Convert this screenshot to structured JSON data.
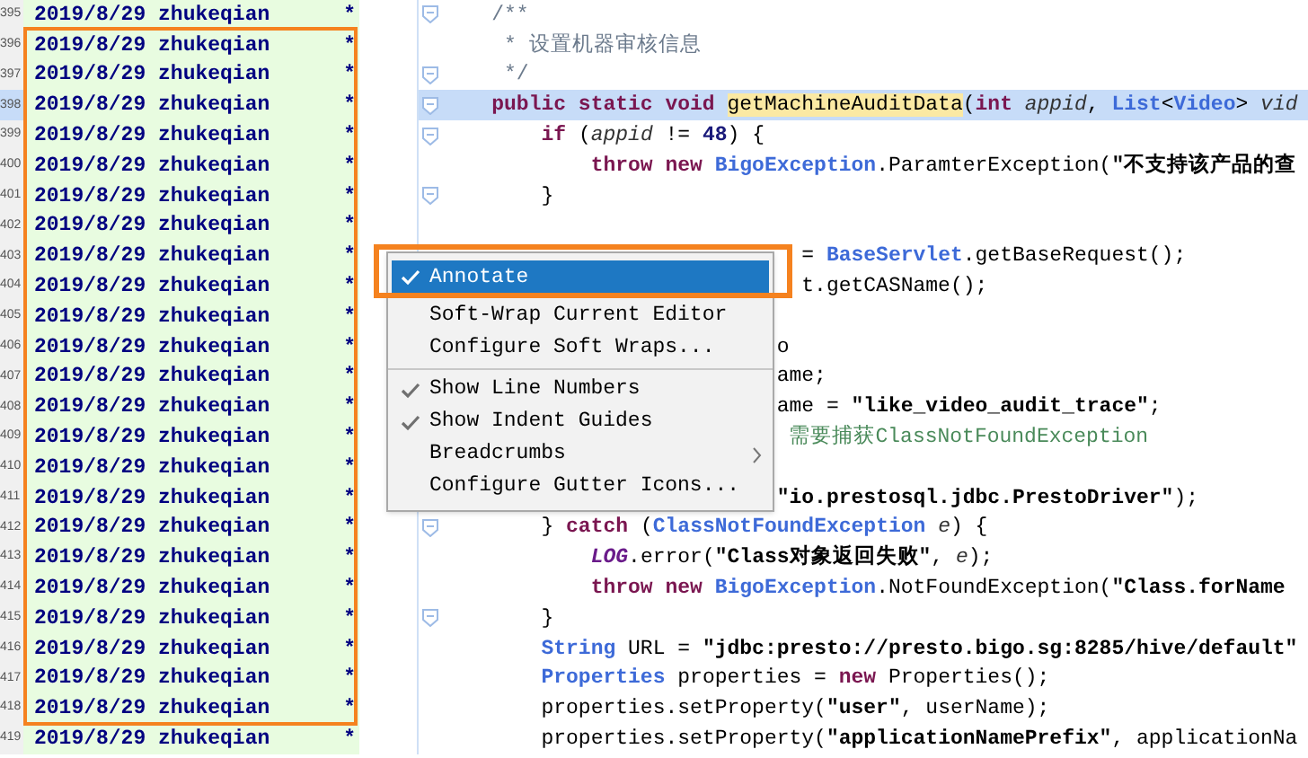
{
  "editor": {
    "lines": [
      {
        "number": "395",
        "annotation": "2019/8/29 zhukeqian",
        "mark": "*",
        "selected": false,
        "fold": true,
        "tokens": [
          {
            "kind": "comment",
            "text": "    /**"
          }
        ]
      },
      {
        "number": "396",
        "annotation": "2019/8/29 zhukeqian",
        "mark": "*",
        "selected": false,
        "fold": false,
        "tokens": [
          {
            "kind": "comment",
            "text": "     * 设置机器审核信息"
          }
        ]
      },
      {
        "number": "397",
        "annotation": "2019/8/29 zhukeqian",
        "mark": "*",
        "selected": false,
        "fold": true,
        "tokens": [
          {
            "kind": "comment",
            "text": "     */"
          }
        ]
      },
      {
        "number": "398",
        "annotation": "2019/8/29 zhukeqian",
        "mark": "*",
        "selected": true,
        "fold": true,
        "tokens": [
          {
            "kind": "keyword",
            "text": "    public static void "
          },
          {
            "kind": "decl",
            "text": "getMachineAuditData"
          },
          {
            "kind": "plain",
            "text": "("
          },
          {
            "kind": "keyword",
            "text": "int "
          },
          {
            "kind": "param",
            "text": "appid"
          },
          {
            "kind": "plain",
            "text": ", "
          },
          {
            "kind": "type",
            "text": "List"
          },
          {
            "kind": "plain",
            "text": "<"
          },
          {
            "kind": "type",
            "text": "Video"
          },
          {
            "kind": "plain",
            "text": "> "
          },
          {
            "kind": "param",
            "text": "vid"
          }
        ]
      },
      {
        "number": "399",
        "annotation": "2019/8/29 zhukeqian",
        "mark": "*",
        "selected": false,
        "fold": true,
        "tokens": [
          {
            "kind": "keyword",
            "text": "        if "
          },
          {
            "kind": "plain",
            "text": "("
          },
          {
            "kind": "param",
            "text": "appid"
          },
          {
            "kind": "plain",
            "text": " != "
          },
          {
            "kind": "number",
            "text": "48"
          },
          {
            "kind": "plain",
            "text": ") {"
          }
        ]
      },
      {
        "number": "400",
        "annotation": "2019/8/29 zhukeqian",
        "mark": "*",
        "selected": false,
        "fold": false,
        "tokens": [
          {
            "kind": "keyword",
            "text": "            throw new "
          },
          {
            "kind": "type",
            "text": "BigoException"
          },
          {
            "kind": "plain",
            "text": ".ParamterException("
          },
          {
            "kind": "string",
            "text": "\"不支持该产品的查"
          }
        ]
      },
      {
        "number": "401",
        "annotation": "2019/8/29 zhukeqian",
        "mark": "*",
        "selected": false,
        "fold": true,
        "tokens": [
          {
            "kind": "plain",
            "text": "        }"
          }
        ]
      },
      {
        "number": "402",
        "annotation": "2019/8/29 zhukeqian",
        "mark": "*",
        "selected": false,
        "fold": false
      },
      {
        "number": "403",
        "annotation": "2019/8/29 zhukeqian",
        "mark": "*",
        "selected": false,
        "fold": false,
        "tokens": [
          {
            "kind": "plain",
            "text": "                             = "
          },
          {
            "kind": "type",
            "text": "BaseServlet"
          },
          {
            "kind": "plain",
            "text": ".getBaseRequest();"
          }
        ]
      },
      {
        "number": "404",
        "annotation": "2019/8/29 zhukeqian",
        "mark": "*",
        "selected": false,
        "fold": false,
        "tokens": [
          {
            "kind": "plain",
            "text": "                             t.getCASName();"
          }
        ]
      },
      {
        "number": "405",
        "annotation": "2019/8/29 zhukeqian",
        "mark": "*",
        "selected": false,
        "fold": false
      },
      {
        "number": "406",
        "annotation": "2019/8/29 zhukeqian",
        "mark": "*",
        "selected": false,
        "fold": false,
        "tokens": [
          {
            "kind": "plain",
            "text": "                           o"
          }
        ]
      },
      {
        "number": "407",
        "annotation": "2019/8/29 zhukeqian",
        "mark": "*",
        "selected": false,
        "fold": false,
        "tokens": [
          {
            "kind": "plain",
            "text": "                           ame;"
          }
        ]
      },
      {
        "number": "408",
        "annotation": "2019/8/29 zhukeqian",
        "mark": "*",
        "selected": false,
        "fold": false,
        "tokens": [
          {
            "kind": "plain",
            "text": "                           ame = "
          },
          {
            "kind": "string",
            "text": "\"like_video_audit_trace\""
          },
          {
            "kind": "plain",
            "text": ";"
          }
        ]
      },
      {
        "number": "409",
        "annotation": "2019/8/29 zhukeqian",
        "mark": "*",
        "selected": false,
        "fold": false,
        "tokens": [
          {
            "kind": "cn_comment",
            "text": "                            需要捕获ClassNotFoundException"
          }
        ]
      },
      {
        "number": "410",
        "annotation": "2019/8/29 zhukeqian",
        "mark": "*",
        "selected": false,
        "fold": false
      },
      {
        "number": "411",
        "annotation": "2019/8/29 zhukeqian",
        "mark": "*",
        "selected": false,
        "fold": false,
        "tokens": [
          {
            "kind": "string",
            "text": "                           \"io.prestosql.jdbc.PrestoDriver\""
          },
          {
            "kind": "plain",
            "text": ");"
          }
        ]
      },
      {
        "number": "412",
        "annotation": "2019/8/29 zhukeqian",
        "mark": "*",
        "selected": false,
        "fold": true,
        "tokens": [
          {
            "kind": "plain",
            "text": "        } "
          },
          {
            "kind": "keyword",
            "text": "catch "
          },
          {
            "kind": "plain",
            "text": "("
          },
          {
            "kind": "type",
            "text": "ClassNotFoundException "
          },
          {
            "kind": "param",
            "text": "e"
          },
          {
            "kind": "plain",
            "text": ") {"
          }
        ]
      },
      {
        "number": "413",
        "annotation": "2019/8/29 zhukeqian",
        "mark": "*",
        "selected": false,
        "fold": false,
        "tokens": [
          {
            "kind": "static",
            "text": "            LOG"
          },
          {
            "kind": "plain",
            "text": ".error("
          },
          {
            "kind": "string",
            "text": "\"Class对象返回失败\""
          },
          {
            "kind": "plain",
            "text": ", "
          },
          {
            "kind": "param",
            "text": "e"
          },
          {
            "kind": "plain",
            "text": ");"
          }
        ]
      },
      {
        "number": "414",
        "annotation": "2019/8/29 zhukeqian",
        "mark": "*",
        "selected": false,
        "fold": false,
        "tokens": [
          {
            "kind": "keyword",
            "text": "            throw new "
          },
          {
            "kind": "type",
            "text": "BigoException"
          },
          {
            "kind": "plain",
            "text": ".NotFoundException("
          },
          {
            "kind": "string",
            "text": "\"Class.forName"
          }
        ]
      },
      {
        "number": "415",
        "annotation": "2019/8/29 zhukeqian",
        "mark": "*",
        "selected": false,
        "fold": true,
        "tokens": [
          {
            "kind": "plain",
            "text": "        }"
          }
        ]
      },
      {
        "number": "416",
        "annotation": "2019/8/29 zhukeqian",
        "mark": "*",
        "selected": false,
        "fold": false,
        "tokens": [
          {
            "kind": "type",
            "text": "        String "
          },
          {
            "kind": "plain",
            "text": "URL = "
          },
          {
            "kind": "string",
            "text": "\"jdbc:presto://presto.bigo.sg:8285/hive/default\""
          }
        ]
      },
      {
        "number": "417",
        "annotation": "2019/8/29 zhukeqian",
        "mark": "*",
        "selected": false,
        "fold": false,
        "tokens": [
          {
            "kind": "type",
            "text": "        Properties "
          },
          {
            "kind": "plain",
            "text": "properties = "
          },
          {
            "kind": "keyword",
            "text": "new "
          },
          {
            "kind": "plain",
            "text": "Properties();"
          }
        ]
      },
      {
        "number": "418",
        "annotation": "2019/8/29 zhukeqian",
        "mark": "*",
        "selected": false,
        "fold": false,
        "tokens": [
          {
            "kind": "plain",
            "text": "        properties.setProperty("
          },
          {
            "kind": "string",
            "text": "\"user\""
          },
          {
            "kind": "plain",
            "text": ", userName);"
          }
        ]
      },
      {
        "number": "419",
        "annotation": "2019/8/29 zhukeqian",
        "mark": "*",
        "selected": false,
        "fold": false,
        "tokens": [
          {
            "kind": "plain",
            "text": "        properties.setProperty("
          },
          {
            "kind": "string",
            "text": "\"applicationNamePrefix\""
          },
          {
            "kind": "plain",
            "text": ", applicationNa"
          }
        ]
      }
    ]
  },
  "context_menu": {
    "items": [
      {
        "kind": "item",
        "label": "Annotate",
        "checked": true,
        "selected": true,
        "submenu": false
      },
      {
        "kind": "item",
        "label": "Soft-Wrap Current Editor",
        "checked": false,
        "selected": false,
        "submenu": false
      },
      {
        "kind": "item",
        "label": "Configure Soft Wraps...",
        "checked": false,
        "selected": false,
        "submenu": false
      },
      {
        "kind": "separator"
      },
      {
        "kind": "item",
        "label": "Show Line Numbers",
        "checked": true,
        "selected": false,
        "submenu": false
      },
      {
        "kind": "item",
        "label": "Show Indent Guides",
        "checked": true,
        "selected": false,
        "submenu": false
      },
      {
        "kind": "item",
        "label": "Breadcrumbs",
        "checked": false,
        "selected": false,
        "submenu": true
      },
      {
        "kind": "item",
        "label": "Configure Gutter Icons...",
        "checked": false,
        "selected": false,
        "submenu": false
      }
    ]
  }
}
